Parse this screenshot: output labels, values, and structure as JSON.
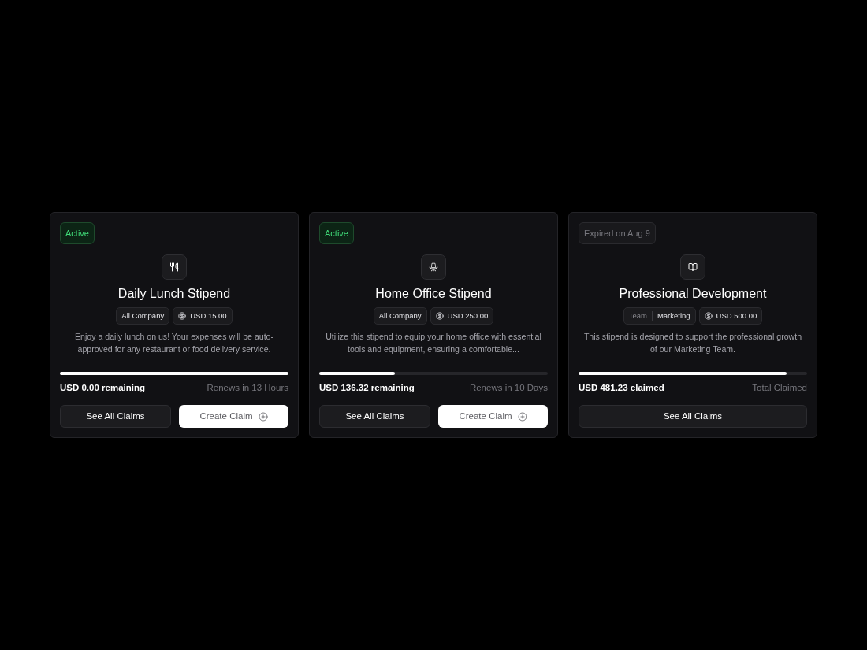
{
  "cards": [
    {
      "kind": "meals",
      "status": {
        "kind": "active",
        "label": "Active"
      },
      "title": "Daily Lunch Stipend",
      "tags": [
        {
          "kind": "audience",
          "label": "All Company"
        },
        {
          "kind": "amount",
          "label": "USD 15.00"
        }
      ],
      "description": "Enjoy a daily lunch on us! Your expenses will be auto-approved for any restaurant or food delivery service.",
      "progress": {
        "level": 1.0
      },
      "amount_text": "USD 0.00 remaining",
      "note": "Renews in 13 Hours",
      "buttons": [
        {
          "kind": "view",
          "label": "See All Claims"
        },
        {
          "kind": "create",
          "label": "Create Claim"
        }
      ]
    },
    {
      "kind": "office",
      "status": {
        "kind": "active",
        "label": "Active"
      },
      "title": "Home Office Stipend",
      "tags": [
        {
          "kind": "audience",
          "label": "All Company"
        },
        {
          "kind": "amount",
          "label": "USD 250.00"
        }
      ],
      "description": "Utilize this stipend to equip your home office with essential tools and equipment, ensuring a comfortable...",
      "progress": {
        "level": 0.33
      },
      "amount_text": "USD 136.32 remaining",
      "note": "Renews in 10 Days",
      "buttons": [
        {
          "kind": "view",
          "label": "See All Claims"
        },
        {
          "kind": "create",
          "label": "Create Claim"
        }
      ]
    },
    {
      "kind": "learning",
      "status": {
        "kind": "expired",
        "label": "Expired on Aug 9"
      },
      "title": "Professional Development",
      "tags": [
        {
          "kind": "team",
          "label": "Team",
          "value": "Marketing"
        },
        {
          "kind": "amount",
          "label": "USD 500.00"
        }
      ],
      "description": "This stipend is designed to support the professional growth of our Marketing Team.",
      "progress": {
        "level": 0.91
      },
      "amount_text": "USD 481.23 claimed",
      "note": "Total Claimed",
      "buttons": [
        {
          "kind": "view",
          "label": "See All Claims"
        }
      ]
    }
  ]
}
